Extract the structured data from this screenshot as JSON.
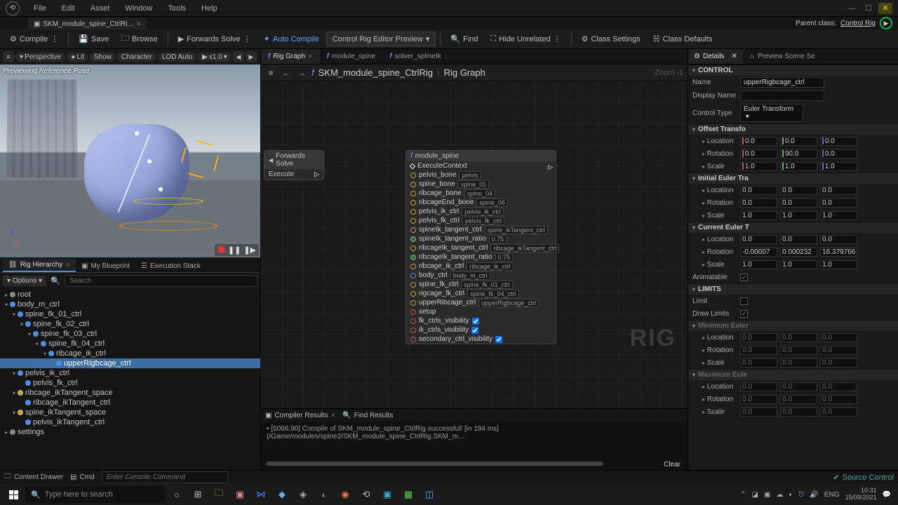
{
  "menubar": [
    "File",
    "Edit",
    "Asset",
    "Window",
    "Tools",
    "Help"
  ],
  "filetab": {
    "name": "SKM_module_spine_CtrlRi...",
    "parent_label": "Parent class:",
    "parent_link": "Control Rig"
  },
  "toolbar": {
    "compile": "Compile",
    "save": "Save",
    "browse": "Browse",
    "forwards": "Forwards Solve",
    "autocompile": "Auto Compile",
    "preview": "Control Rig Editor Preview",
    "find": "Find",
    "hide": "Hide Unrelated",
    "class_settings": "Class Settings",
    "class_defaults": "Class Defaults"
  },
  "viewport": {
    "overlay": "Previewing Reference Pose",
    "buttons": {
      "persp": "Perspective",
      "lit": "Lit",
      "show": "Show",
      "character": "Character",
      "lod": "LOD Auto",
      "speed": "x1.0"
    }
  },
  "left_tabs": {
    "hierarchy": "Rig Hierarchy",
    "blueprint": "My Blueprint",
    "exec": "Execution Stack"
  },
  "options_label": "Options",
  "search_placeholder": "Search",
  "tree": [
    {
      "d": 0,
      "t": "root",
      "dot": "grey",
      "tw": "▸"
    },
    {
      "d": 0,
      "t": "body_m_ctrl",
      "dot": "blue",
      "tw": "▾"
    },
    {
      "d": 1,
      "t": "spine_fk_01_ctrl",
      "dot": "blue",
      "tw": "▾"
    },
    {
      "d": 2,
      "t": "spine_fk_02_ctrl",
      "dot": "blue",
      "tw": "▾"
    },
    {
      "d": 3,
      "t": "spine_fk_03_ctrl",
      "dot": "blue",
      "tw": "▾"
    },
    {
      "d": 4,
      "t": "spine_fk_04_ctrl",
      "dot": "blue",
      "tw": "▾"
    },
    {
      "d": 5,
      "t": "ribcage_ik_ctrl",
      "dot": "blue",
      "tw": "▾"
    },
    {
      "d": 6,
      "t": "upperRigbcage_ctrl",
      "dot": "blue",
      "sel": true
    },
    {
      "d": 1,
      "t": "pelvis_ik_ctrl",
      "dot": "blue",
      "tw": "▾"
    },
    {
      "d": 2,
      "t": "pelvis_fk_ctrl",
      "dot": "blue"
    },
    {
      "d": 1,
      "t": "ribcage_ikTangent_space",
      "dot": "gold",
      "tw": "▾"
    },
    {
      "d": 2,
      "t": "ribcage_ikTangent_ctrl",
      "dot": "blue"
    },
    {
      "d": 1,
      "t": "spine_ikTangent_space",
      "dot": "gold",
      "tw": "▾"
    },
    {
      "d": 2,
      "t": "pelvis_ikTangent_ctrl",
      "dot": "blue"
    },
    {
      "d": 0,
      "t": "settings",
      "dot": "grey",
      "tw": "▸"
    }
  ],
  "graph_tabs": [
    {
      "label": "Rig Graph",
      "active": true,
      "close": true
    },
    {
      "label": "module_spine"
    },
    {
      "label": "solver_splineIk"
    }
  ],
  "breadcrumb": {
    "asset": "SKM_module_spine_CtrlRig",
    "graph": "Rig Graph",
    "zoom": "Zoom -1"
  },
  "node1": {
    "title": "Forwards Solve",
    "exec": "Execute"
  },
  "node2": {
    "title": "module_spine",
    "ports": [
      {
        "type": "exec",
        "label": "ExecuteContext"
      },
      {
        "type": "gold",
        "label": "pelvis_bone",
        "val": "pelvis"
      },
      {
        "type": "gold",
        "label": "spine_bone",
        "val": "spine_01"
      },
      {
        "type": "gold",
        "label": "ribcage_bone",
        "val": "spine_04"
      },
      {
        "type": "gold",
        "label": "ribcageEnd_bone",
        "val": "spine_06"
      },
      {
        "type": "gold",
        "label": "pelvis_ik_ctrl",
        "val": "pelvis_ik_ctrl"
      },
      {
        "type": "gold",
        "label": "pelvis_fk_ctrl",
        "val": "pelvis_fk_ctrl"
      },
      {
        "type": "gold",
        "label": "spineIk_tangent_ctrl",
        "val": "spine_ikTangent_ctrl"
      },
      {
        "type": "grn",
        "label": "spineIk_tangent_ratio",
        "val": "0.75"
      },
      {
        "type": "gold",
        "label": "ribcageIk_tangent_ctrl",
        "val": "ribcage_ikTangent_ctrl"
      },
      {
        "type": "grn",
        "label": "ribcageIk_tangent_ratio",
        "val": "0.75"
      },
      {
        "type": "gold",
        "label": "ribcage_ik_ctrl",
        "val": "ribcage_ik_ctrl"
      },
      {
        "type": "blu",
        "label": "body_ctrl",
        "val": "body_m_ctrl"
      },
      {
        "type": "gold",
        "label": "spine_fk_ctrl",
        "val": "spine_fk_01_ctrl"
      },
      {
        "type": "gold",
        "label": "rigcage_fk_ctrl",
        "val": "spine_fk_04_ctrl"
      },
      {
        "type": "gold",
        "label": "upperRibcage_ctrl",
        "val": "upperRigbcage_ctrl"
      },
      {
        "type": "red",
        "label": "setup"
      },
      {
        "type": "red",
        "label": "fk_ctrls_visibility",
        "check": true
      },
      {
        "type": "red",
        "label": "ik_ctrls_visibility",
        "check": true
      },
      {
        "type": "red",
        "label": "secondary_ctrl_visibility",
        "check": true
      }
    ]
  },
  "compiler": {
    "tab1": "Compiler Results",
    "tab2": "Find Results",
    "log": "• [5066.90] Compile of SKM_module_spine_CtrlRig successful! [in 194 ms] (/Game/modules/spine2/SKM_module_spine_CtrlRig.SKM_m...",
    "clear": "Clear"
  },
  "right_tabs": {
    "details": "Details",
    "preview": "Preview Scene Se"
  },
  "details": {
    "cat_control": "CONTROL",
    "name_label": "Name",
    "name": "upperRigbcage_ctrl",
    "display_label": "Display Name",
    "display": "",
    "type_label": "Control Type",
    "type": "Euler Transform",
    "cat_offset": "Offset Transfo",
    "location": "Location",
    "rotation": "Rotation",
    "scale": "Scale",
    "off_loc": [
      "0.0",
      "0.0",
      "0.0"
    ],
    "off_rot": [
      "0.0",
      "90.0",
      "0.0"
    ],
    "off_scl": [
      "1.0",
      "1.0",
      "1.0"
    ],
    "cat_initial": "Initial Euler Tra",
    "ini_loc": [
      "0.0",
      "0.0",
      "0.0"
    ],
    "ini_rot": [
      "0.0",
      "0.0",
      "0.0"
    ],
    "ini_scl": [
      "1.0",
      "1.0",
      "1.0"
    ],
    "cat_current": "Current Euler T",
    "cur_loc": [
      "0.0",
      "0.0",
      "0.0"
    ],
    "cur_rot": [
      "-0.00007",
      "0.000232",
      "16.379766"
    ],
    "cur_scl": [
      "1.0",
      "1.0",
      "1.0"
    ],
    "anim_label": "Animatable",
    "cat_limits": "LIMITS",
    "limit_label": "Limit",
    "draw_limits": "Draw Limits",
    "cat_min": "Minimum Euler",
    "min_loc": [
      "0.0",
      "0.0",
      "0.0"
    ],
    "min_rot": [
      "0.0",
      "0.0",
      "0.0"
    ],
    "min_scl": [
      "0.0",
      "0.0",
      "0.0"
    ],
    "cat_max": "Maximum Eule",
    "max_loc": [
      "0.0",
      "0.0",
      "0.0"
    ],
    "max_rot": [
      "0.0",
      "0.0",
      "0.0"
    ],
    "max_scl": [
      "0.0",
      "0.0",
      "0.0"
    ]
  },
  "bottom": {
    "drawer": "Content Drawer",
    "cmd": "Cmd",
    "cmd_ph": "Enter Console Command",
    "src": "Source Control"
  },
  "taskbar": {
    "search": "Type here to search",
    "time": "10:31",
    "date": "15/09/2021",
    "lang": "ENG"
  }
}
